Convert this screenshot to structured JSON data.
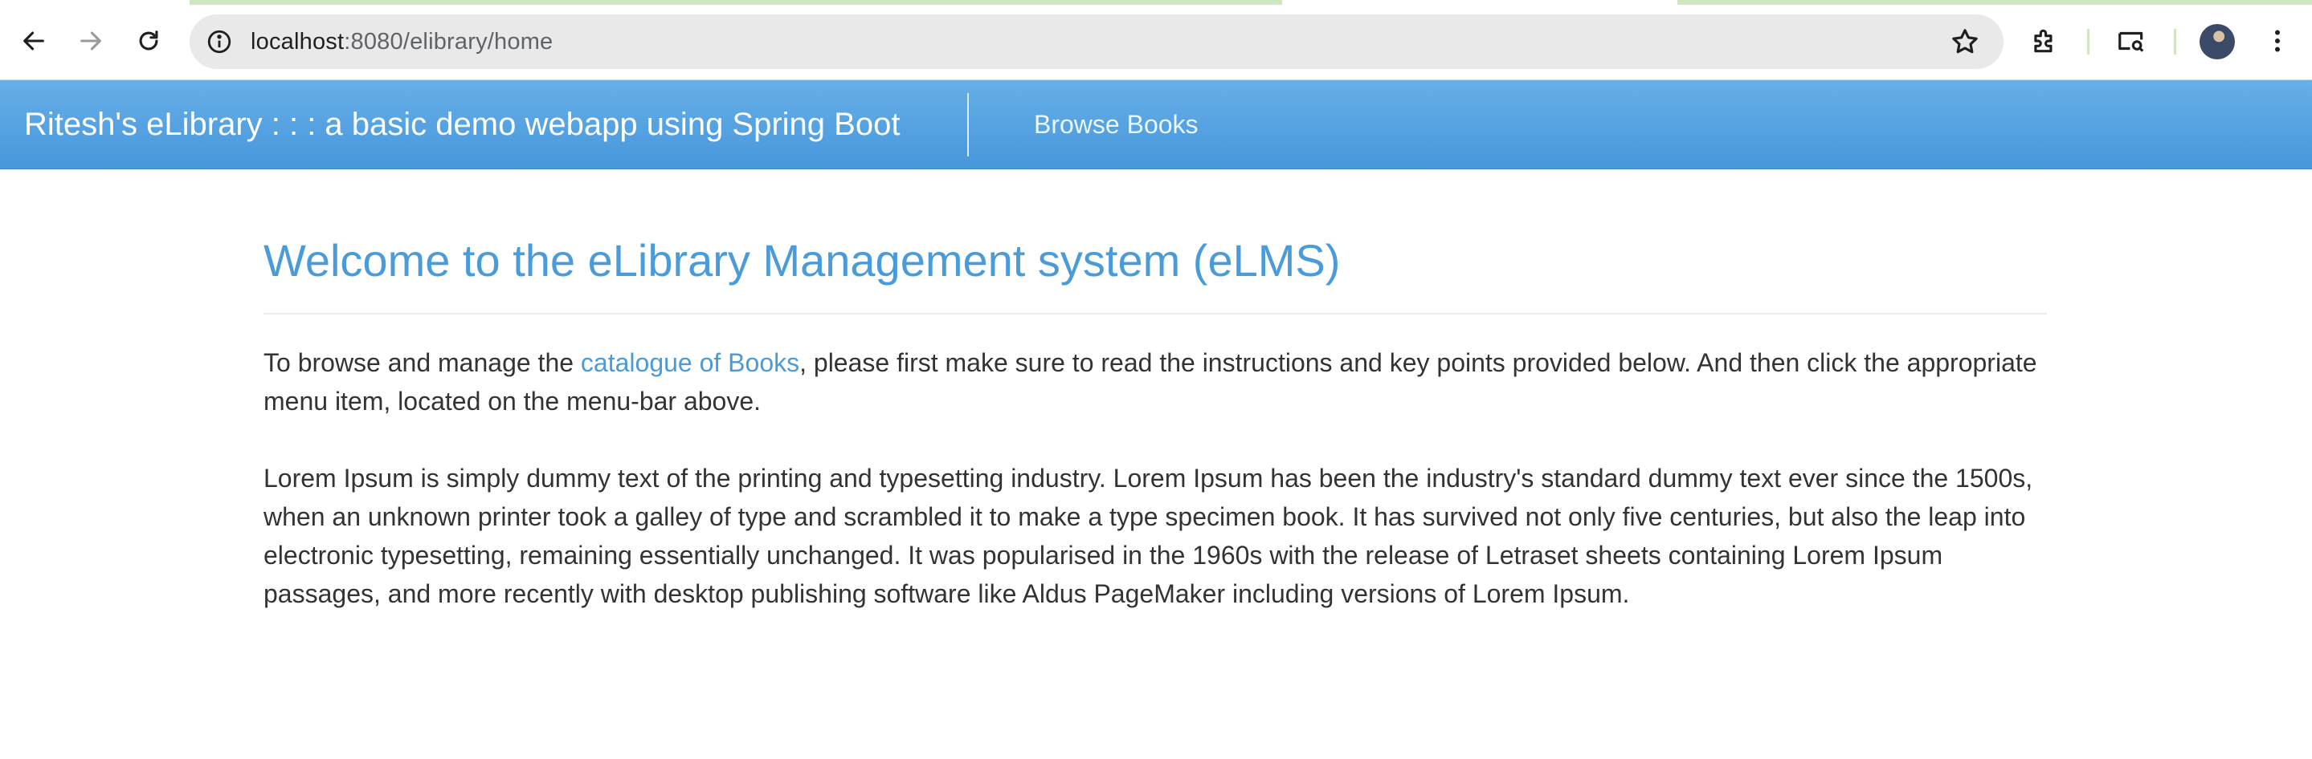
{
  "browser": {
    "url_host": "localhost",
    "url_path": ":8080/elibrary/home",
    "icons": {
      "back": "arrow-left-icon",
      "forward": "arrow-right-icon",
      "reload": "reload-icon",
      "site_info": "info-icon",
      "bookmark": "star-icon",
      "extensions": "puzzle-icon",
      "media": "cast-search-icon",
      "menu": "kebab-menu-icon"
    },
    "accent_loading": "#cfe6c2"
  },
  "navbar": {
    "brand": "Ritesh's eLibrary : : : a basic demo webapp using Spring Boot",
    "links": [
      {
        "label": "Browse Books"
      }
    ],
    "bg_color": "#4a9bd9"
  },
  "main": {
    "title": "Welcome to the eLibrary Management system (eLMS)",
    "intro": {
      "before_link": "To browse and manage the ",
      "link_text": "catalogue of Books",
      "after_link": ", please first make sure to read the instructions and key points provided below. And then click the appropriate menu item, located on the menu-bar above."
    },
    "lorem": "Lorem Ipsum is simply dummy text of the printing and typesetting industry. Lorem Ipsum has been the industry's standard dummy text ever since the 1500s, when an unknown printer took a galley of type and scrambled it to make a type specimen book. It has survived not only five centuries, but also the leap into electronic typesetting, remaining essentially unchanged. It was popularised in the 1960s with the release of Letraset sheets containing Lorem Ipsum passages, and more recently with desktop publishing software like Aldus PageMaker including versions of Lorem Ipsum.",
    "accent_color": "#4a9bd9",
    "text_color": "#333333"
  }
}
